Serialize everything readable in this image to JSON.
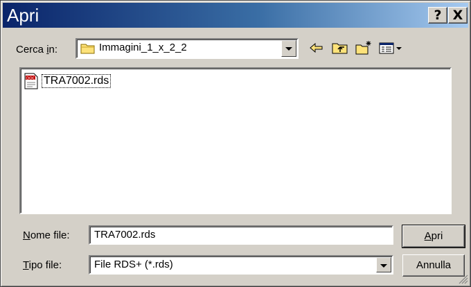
{
  "dialog": {
    "title": "Apri",
    "help_label": "?",
    "close_label": "X"
  },
  "lookin": {
    "label_pre": "Cerca ",
    "label_accel": "i",
    "label_post": "n:",
    "folder": "Immagini_1_x_2_2",
    "folder_icon": "folder-icon"
  },
  "toolbar": {
    "icons": [
      "back-arrow-icon",
      "up-folder-icon",
      "new-folder-icon",
      "view-menu-icon"
    ]
  },
  "files": [
    {
      "name": "TRA7002.rds",
      "icon": "doc-file-icon",
      "icon_text": "DOC"
    }
  ],
  "filename": {
    "label_accel": "N",
    "label_rest": "ome file:",
    "value": "TRA7002.rds"
  },
  "filetype": {
    "label_accel": "T",
    "label_rest": "ipo file:",
    "value": "File RDS+ (*.rds)"
  },
  "buttons": {
    "open_accel": "A",
    "open_rest": "pri",
    "cancel": "Annulla"
  },
  "colors": {
    "title_start": "#0a246a",
    "title_end": "#a6caf0",
    "face": "#d4d0c8"
  }
}
